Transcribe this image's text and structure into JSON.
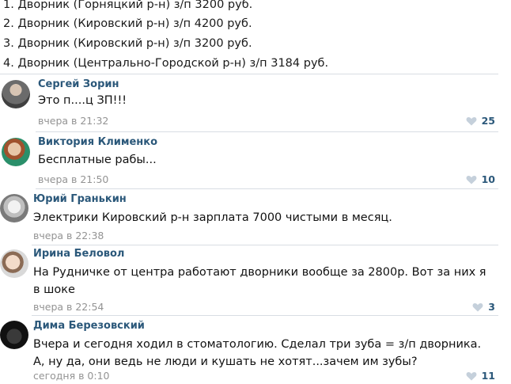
{
  "post": {
    "lines": [
      "1. Дворник (Горняцкий р-н) з/п 3200 руб.",
      "2. Дворник (Кировский р-н) з/п 4200 руб.",
      "3. Дворник (Кировский р-н) з/п 3200 руб.",
      "4. Дворник (Центрально-Городской р-н) з/п 3184 руб."
    ]
  },
  "comments": [
    {
      "author": "Сергей Зорин",
      "text": "Это п....ц ЗП!!!",
      "time": "вчера в 21:32",
      "likes": "25"
    },
    {
      "author": "Виктория Клименко",
      "text": "Бесплатные рабы...",
      "time": "вчера в 21:50",
      "likes": "10"
    },
    {
      "author": "Юрий Гранькин",
      "text": "Электрики Кировский р-н зарплата 7000 чистыми в месяц.",
      "time": "вчера в 22:38",
      "likes": ""
    },
    {
      "author": "Ирина Беловол",
      "text": "На Рудничке от центра работают дворники вообще за 2800р. Вот за них я в шоке",
      "time": "вчера в 22:54",
      "likes": "3"
    },
    {
      "author": "Дима Березовский",
      "text": "Вчера и сегодня ходил в стоматологию. Сделал три зуба = з/п дворника. А, ну да, они ведь не люди и кушать не хотят...зачем им зубы?",
      "time": "сегодня в 0:10",
      "likes": "11"
    }
  ],
  "icons": {
    "like": "heart-icon"
  },
  "colors": {
    "author": "#2b587a",
    "meta": "#939393",
    "divider": "#d8dde3",
    "like_icon": "#c5d0db"
  }
}
